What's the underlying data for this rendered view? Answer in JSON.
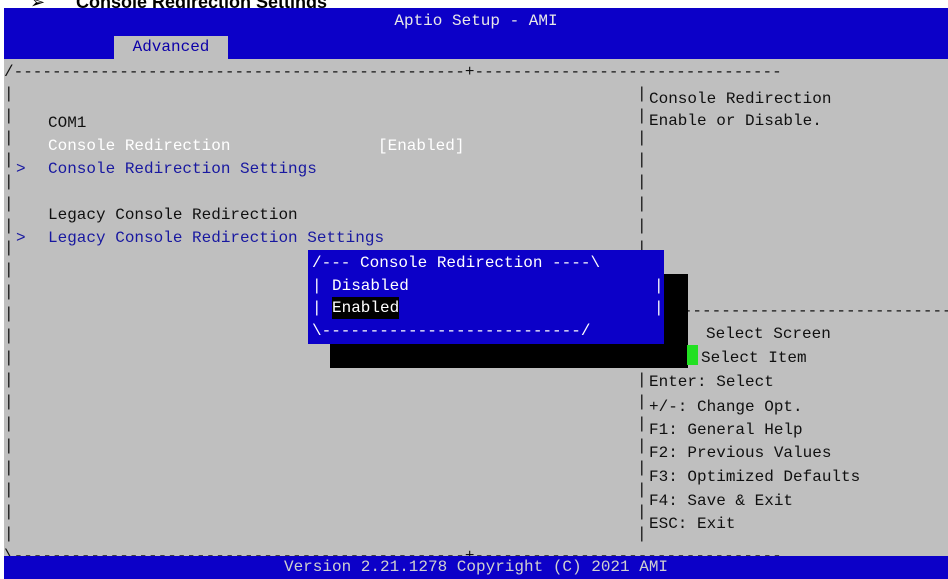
{
  "document": {
    "bullet": "➢",
    "heading": "Console Redirection Settings"
  },
  "bios": {
    "app_title": "Aptio Setup - AMI",
    "active_tab": "Advanced",
    "footer": "Version 2.21.1278 Copyright (C) 2021 AMI",
    "frame": {
      "top_left": "/-----------------------------------------------+--------------------------------",
      "bottom_left": "\\-----------------------------------------------+--------------------------------",
      "left_border": "|",
      "divider": "|",
      "help_separator": "---------------------------------"
    },
    "left_panel": {
      "com_label": "COM1",
      "console_redirection_label": "Console Redirection",
      "console_redirection_value": "[Enabled]",
      "submenu_marker": ">",
      "console_settings_link": "Console Redirection Settings",
      "legacy_label": "Legacy Console Redirection",
      "legacy_settings_link": "Legacy Console Redirection Settings"
    },
    "help_text": {
      "line1": "Console Redirection",
      "line2": "Enable or Disable."
    },
    "key_help": [
      "Select Screen",
      "Select Item",
      "Enter: Select",
      "+/-: Change Opt.",
      "F1: General Help",
      "F2: Previous Values",
      "F3: Optimized Defaults",
      "F4: Save & Exit",
      "ESC: Exit"
    ],
    "popup": {
      "top": "/--- Console Redirection ----\\",
      "options": [
        "Disabled",
        "Enabled"
      ],
      "selected": "Enabled",
      "option_prefix": "| ",
      "right_border": "|",
      "bottom": "\\---------------------------/"
    },
    "colors": {
      "title_blue": "#0c00c8",
      "background_gray": "#bfbfbf",
      "link_blue": "#1818a0",
      "cursor_green": "#22e022"
    }
  }
}
